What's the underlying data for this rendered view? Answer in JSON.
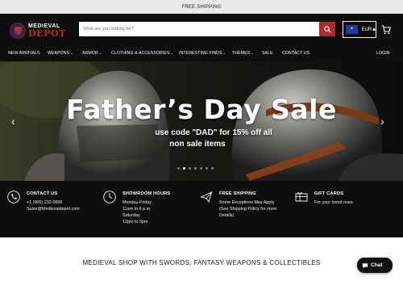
{
  "topbar": {
    "text": "FREE SHIPPING"
  },
  "logo": {
    "line1": "MEDIEVAL",
    "line2": "DEPOT"
  },
  "search": {
    "placeholder": "What are you looking for?"
  },
  "currency": {
    "label": "EUR",
    "flag": "eu-flag"
  },
  "icons": {
    "search": "search-icon",
    "cart": "cart-icon",
    "chat": "chat-icon"
  },
  "nav": {
    "items": [
      {
        "label": "NEW ARRIVALS",
        "dropdown": false
      },
      {
        "label": "WEAPONS",
        "dropdown": true
      },
      {
        "label": "ARMOR",
        "dropdown": true
      },
      {
        "label": "CLOTHING & ACCESSORIES",
        "dropdown": true
      },
      {
        "label": "INTERESTING FINDS",
        "dropdown": true
      },
      {
        "label": "THEMES",
        "dropdown": true
      },
      {
        "label": "SALE",
        "dropdown": false
      },
      {
        "label": "CONTACT US",
        "dropdown": false
      }
    ],
    "login": "LOGIN"
  },
  "hero": {
    "title": "Father’s Day Sale",
    "sub1": "use code \"DAD\" for 15% off all",
    "sub2": "non sale items",
    "prev": "‹",
    "next": "›",
    "dot_count": 7,
    "active_dot": 1
  },
  "info": {
    "contact": {
      "title": "CONTACT US",
      "lines": [
        "+1 (905) 232-0666",
        "Sales@Medievaldepot.com"
      ]
    },
    "showroom": {
      "title": "SHOWROOM HOURS",
      "lines": [
        "Monday-Friday",
        "11am to 6 p.m.",
        "Saturday",
        "12pm to 5pm"
      ]
    },
    "shipping": {
      "title": "FREE SHIPPING",
      "lines": [
        "Some Exceptions May Apply",
        "(See Shipping Policy for more",
        "Details)"
      ]
    },
    "gift": {
      "title": "GIFT CARDS",
      "lines": [
        "For your loved ones"
      ]
    }
  },
  "tagline": "MEDIEVAL SHOP WITH SWORDS, FANTASY WEAPONS & COLLECTIBLES",
  "chat": {
    "label": "Chat"
  },
  "colors": {
    "accent": "#b12a2a",
    "dark": "#0e0e0e",
    "topbar": "#e8e8e8"
  }
}
